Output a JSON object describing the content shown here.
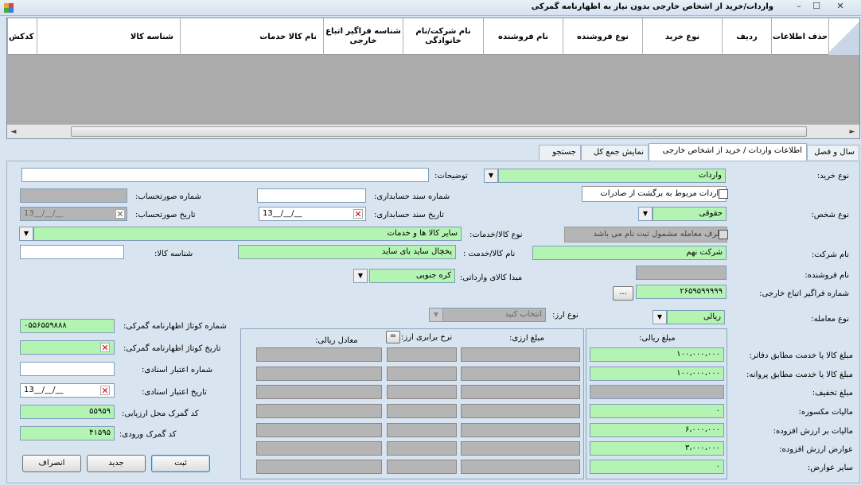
{
  "window": {
    "title": "واردات/خرید از اشخاص خارجی بدون نیاز به اظهارنامه گمرکی",
    "minimize": "–",
    "maximize": "☐",
    "close": "✕"
  },
  "grid": {
    "columns": [
      "حذف اطلاعات",
      "ردیف",
      "نوع خرید",
      "نوع فروشنده",
      "نام فروشنده",
      "نام شرکت/نام خانوادگی",
      "شناسه فراگیر اتباع خارجی",
      "نام کالا خدمات",
      "شناسه کالا",
      "کدکش"
    ],
    "scroll_left": "◄",
    "scroll_right": "►"
  },
  "tabs": [
    "سال و فصل",
    "اطلاعات واردات / خرید از اشخاص خارجی",
    "نمایش جمع کل",
    "جستجو"
  ],
  "form": {
    "purchase_type_label": "نوع خرید:",
    "purchase_type_value": "واردات",
    "description_label": "توضیحات:",
    "description_value": "",
    "export_return_label": "واردات مربوط به برگشت از صادرات",
    "accounting_doc_no_label": "شماره سند حسابداری:",
    "accounting_doc_no_value": "",
    "statement_no_label": "شماره صورتحساب:",
    "statement_no_value": "",
    "person_type_label": "نوع شخص:",
    "person_type_value": "حقوقی",
    "accounting_doc_date_label": "تاریخ سند حسابداری:",
    "accounting_doc_date_value": "13__/__/__",
    "statement_date_label": "تاریخ صورتحساب:",
    "statement_date_value": "13__/__/__",
    "unregistered_party_label": "طرف معامله مشمول ثبت نام می باشد",
    "goods_type_label": "نوع کالا/خدمات:",
    "goods_type_value": "سایر کالا ها و خدمات",
    "company_name_label": "نام شرکت:",
    "company_name_value": "شرکت نهم",
    "goods_name_label": "نام کالا/خدمت :",
    "goods_name_value": "یخچال ساید بای ساید",
    "goods_id_label": "شناسه کالا:",
    "goods_id_value": "",
    "seller_name_label": "نام فروشنده:",
    "seller_name_value": "",
    "origin_label": "مبدا کالای وارداتی:",
    "origin_value": "کره جنوبی",
    "foreign_id_label": "شماره فراگیر اتباع خارجی:",
    "foreign_id_value": "۲۶۵۹۵۹۹۹۹۹",
    "browse_label": "...",
    "deal_type_label": "نوع معامله:",
    "deal_type_value": "ریالی",
    "currency_type_label": "نوع ارز:",
    "currency_type_value": "انتخاب کنید",
    "customs_no_label": "شماره کوتاژ اظهارنامه گمرکی:",
    "customs_no_value": "۰۵۵۶۵۵۹۸۸۸",
    "customs_date_label": "تاریخ کوتاژ اظهارنامه گمرکی:",
    "customs_date_value": "",
    "credit_no_label": "شماره اعتبار اسنادی:",
    "credit_no_value": "",
    "credit_date_label": "تاریخ اعتبار اسنادی:",
    "credit_date_value": "13__/__/__",
    "assess_customs_label": "کد گمرک محل ارزیابی:",
    "assess_customs_value": "۵۵۹۵۹",
    "entry_customs_label": "کد گمرک ورودی:",
    "entry_customs_value": "۴۱۵۹۵"
  },
  "amounts": {
    "rial_header": "مبلغ ریالی:",
    "currency_header": "مبلغ ارزی:",
    "rate_header": "نرخ برابری ارز:",
    "rate_btn": "=",
    "rial_equiv_header": "معادل ریالی:",
    "rows": [
      {
        "label": "مبلغ کالا یا خدمت مطابق دفاتر:",
        "value": "۱۰۰،۰۰۰،۰۰۰"
      },
      {
        "label": "مبلغ کالا یا خدمت مطابق پروانه:",
        "value": "۱۰۰،۰۰۰،۰۰۰"
      },
      {
        "label": "مبلغ تخفیف:",
        "value": ""
      },
      {
        "label": "مالیات مکسوره:",
        "value": "۰"
      },
      {
        "label": "مالیات بر ارزش افزوده:",
        "value": "۶،۰۰۰،۰۰۰"
      },
      {
        "label": "عوارض ارزش افزوده:",
        "value": "۳،۰۰۰،۰۰۰"
      },
      {
        "label": "سایر عوارض:",
        "value": "۰"
      }
    ]
  },
  "buttons": {
    "save": "ثبت",
    "new": "جدید",
    "cancel": "انصراف"
  },
  "colors": {
    "required_field": "#b3f4b3",
    "disabled_field": "#b5b5b5"
  }
}
